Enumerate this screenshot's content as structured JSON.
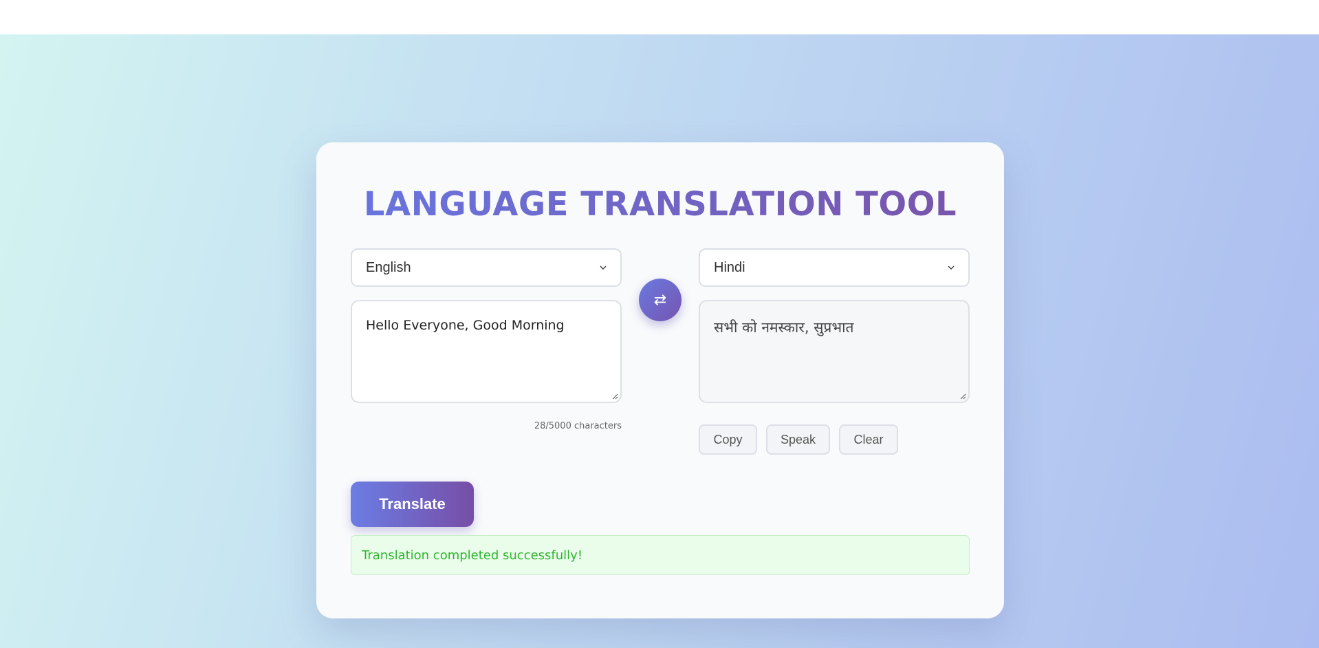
{
  "app": {
    "title": "LANGUAGE TRANSLATION TOOL"
  },
  "source": {
    "language": "English",
    "text": "Hello Everyone, Good Morning",
    "char_count": "28/5000 characters"
  },
  "target": {
    "language": "Hindi",
    "text": "सभी को नमस्कार, सुप्रभात"
  },
  "controls": {
    "swap_icon": "⇄",
    "copy_label": "Copy",
    "speak_label": "Speak",
    "clear_label": "Clear",
    "translate_label": "Translate"
  },
  "status": {
    "message": "Translation completed successfully!",
    "color": "#2fb52f"
  },
  "icons": {
    "swap": "swap-arrows-icon",
    "dropdown": "chevron-down-icon"
  },
  "colors": {
    "accent_start": "#6b7de4",
    "accent_end": "#774ea6"
  }
}
